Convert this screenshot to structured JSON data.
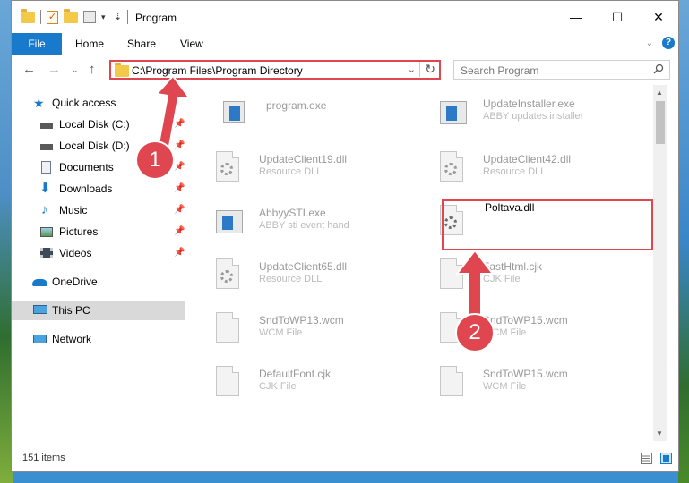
{
  "window": {
    "title": "Program"
  },
  "ribbon": {
    "tabs": [
      "File",
      "Home",
      "Share",
      "View"
    ]
  },
  "address": {
    "path": "C:\\Program Files\\Program Directory"
  },
  "search": {
    "placeholder": "Search Program"
  },
  "nav": {
    "quick_access": "Quick access",
    "items": [
      "Local Disk (C:)",
      "Local Disk (D:)",
      "Documents",
      "Downloads",
      "Music",
      "Pictures",
      "Videos"
    ],
    "onedrive": "OneDrive",
    "thispc": "This PC",
    "network": "Network"
  },
  "files": [
    {
      "name": "program.exe",
      "type": ""
    },
    {
      "name": "UpdateInstaller.exe",
      "type": "ABBY updates installer"
    },
    {
      "name": "UpdateClient19.dll",
      "type": "Resource DLL"
    },
    {
      "name": "UpdateClient42.dll",
      "type": "Resource DLL"
    },
    {
      "name": "AbbyySTI.exe",
      "type": "ABBY sti event hand"
    },
    {
      "name": "Poltava.dll",
      "type": ""
    },
    {
      "name": "UpdateClient65.dll",
      "type": "Resource DLL"
    },
    {
      "name": "FastHtml.cjk",
      "type": "CJK File"
    },
    {
      "name": "SndToWP13.wcm",
      "type": "WCM File"
    },
    {
      "name": "SndToWP15.wcm",
      "type": "WCM File"
    },
    {
      "name": "DefaultFont.cjk",
      "type": "CJK File"
    },
    {
      "name": "SndToWP15.wcm",
      "type": "WCM File"
    }
  ],
  "status": {
    "items_count": "151 items"
  },
  "annotations": {
    "step1": "1",
    "step2": "2"
  },
  "colors": {
    "accent": "#1979ca",
    "highlight": "#e0464f"
  }
}
